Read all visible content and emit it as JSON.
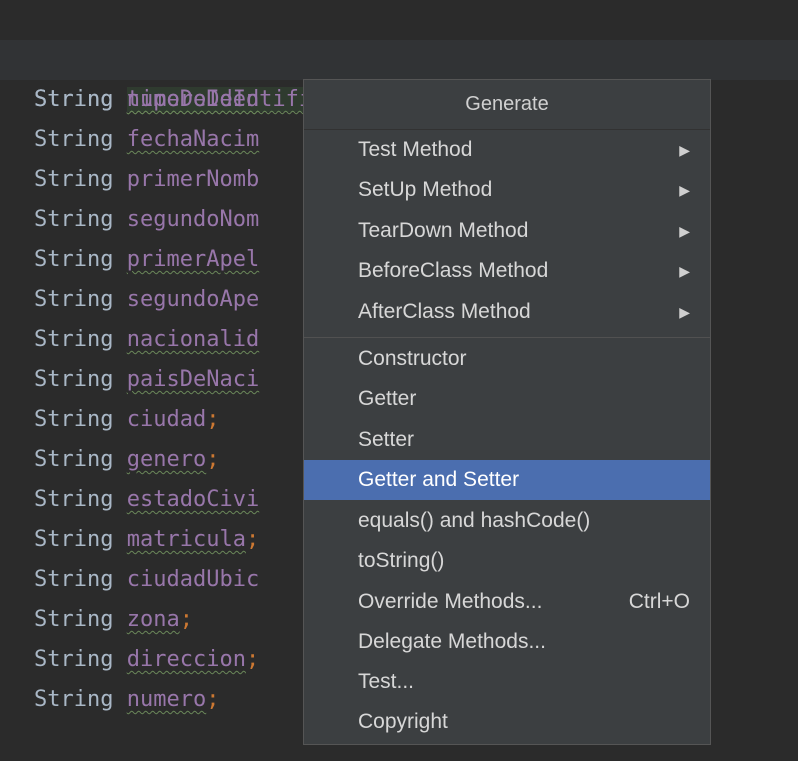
{
  "editor": {
    "type_keyword": "String",
    "lines": [
      {
        "field": "tipoDeIdentificacion",
        "semi": ";"
      },
      {
        "field": "numeroDeId",
        "semi": ""
      },
      {
        "field": "fechaNacim",
        "semi": ""
      },
      {
        "field": "primerNomb",
        "semi": ""
      },
      {
        "field": "segundoNom",
        "semi": ""
      },
      {
        "field": "primerApel",
        "semi": ""
      },
      {
        "field": "segundoApe",
        "semi": ""
      },
      {
        "field": "nacionalid",
        "semi": ""
      },
      {
        "field": "paisDeNaci",
        "semi": ""
      },
      {
        "field": "ciudad",
        "semi": ";"
      },
      {
        "field": "genero",
        "semi": ";"
      },
      {
        "field": "estadoCivi",
        "semi": ""
      },
      {
        "field": "matricula",
        "semi": ";"
      },
      {
        "field": "ciudadUbic",
        "semi": ""
      },
      {
        "field": "zona",
        "semi": ";"
      },
      {
        "field": "direccion",
        "semi": ";"
      },
      {
        "field": "numero",
        "semi": ";"
      }
    ]
  },
  "popup": {
    "title": "Generate",
    "items": [
      {
        "label": "Test Method",
        "submenu": true
      },
      {
        "label": "SetUp Method",
        "submenu": true
      },
      {
        "label": "TearDown Method",
        "submenu": true
      },
      {
        "label": "BeforeClass Method",
        "submenu": true
      },
      {
        "label": "AfterClass Method",
        "submenu": true
      },
      {
        "label": "Constructor",
        "submenu": false
      },
      {
        "label": "Getter",
        "submenu": false
      },
      {
        "label": "Setter",
        "submenu": false
      },
      {
        "label": "Getter and Setter",
        "submenu": false,
        "selected": true
      },
      {
        "label": "equals() and hashCode()",
        "submenu": false
      },
      {
        "label": "toString()",
        "submenu": false
      },
      {
        "label": "Override Methods...",
        "submenu": false,
        "shortcut": "Ctrl+O"
      },
      {
        "label": "Delegate Methods...",
        "submenu": false
      },
      {
        "label": "Test...",
        "submenu": false
      },
      {
        "label": "Copyright",
        "submenu": false
      }
    ],
    "submenu_arrow": "▶"
  },
  "colors": {
    "background": "#2b2b2b",
    "popup_bg": "#3c3f41",
    "selected_bg": "#4b6eaf",
    "field_color": "#9876aa",
    "keyword_color": "#cc7832"
  }
}
